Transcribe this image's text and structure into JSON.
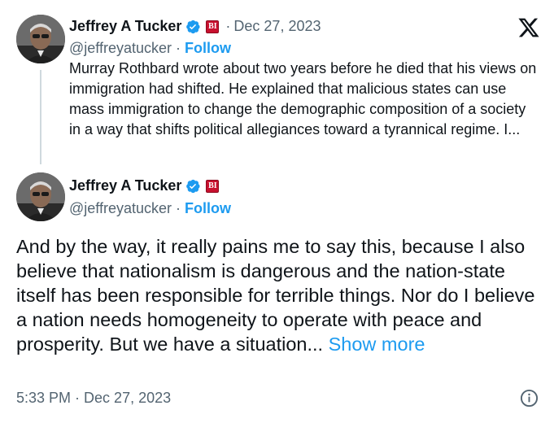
{
  "quoted_tweet": {
    "author_name": "Jeffrey A Tucker",
    "handle": "@jeffreyatucker",
    "follow_label": "Follow",
    "date": "Dec 27, 2023",
    "text": "Murray Rothbard wrote about two years before he died that his views on immigration had shifted. He explained that malicious states can use mass immigration to change the demographic composition of a society in a way that shifts political allegiances toward a tyrannical regime. I..."
  },
  "main_tweet": {
    "author_name": "Jeffrey A Tucker",
    "handle": "@jeffreyatucker",
    "follow_label": "Follow",
    "text": "And by the way, it really pains me to say this, because I also believe that nationalism is dangerous and the nation-state itself has been responsible for terrible things. Nor do I believe a nation needs homogeneity to operate with peace and prosperity. But we have a situation...",
    "show_more_label": "Show more",
    "time": "5:33 PM",
    "date": "Dec 27, 2023"
  },
  "affiliate_badge_text": "BI",
  "separator": "·",
  "icons": {
    "verified": "verified-badge-icon",
    "platform_logo": "x-logo-icon",
    "info": "info-icon"
  },
  "colors": {
    "accent": "#1d9bf0",
    "secondary_text": "#536471",
    "affiliate_badge": "#c8102e",
    "thread_line": "#cfd9de"
  }
}
